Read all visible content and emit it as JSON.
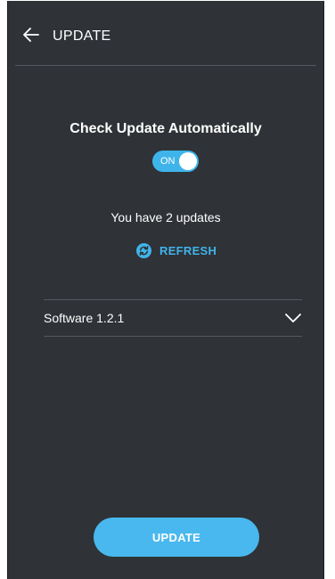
{
  "header": {
    "title": "UPDATE",
    "back_icon": "arrow-left-icon"
  },
  "auto_check": {
    "title": "Check Update Automatically",
    "toggle_label": "ON",
    "toggle_state": true
  },
  "updates": {
    "status_text": "You have 2 updates",
    "refresh_label": "REFRESH",
    "refresh_icon": "refresh-icon"
  },
  "software": {
    "label": "Software 1.2.1",
    "expand_icon": "chevron-down-icon"
  },
  "actions": {
    "update_label": "UPDATE"
  },
  "colors": {
    "background": "#2f3237",
    "accent": "#3fb4ea",
    "text": "#ffffff",
    "divider": "#55595f"
  }
}
